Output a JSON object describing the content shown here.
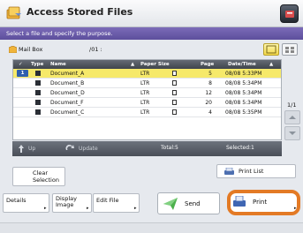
{
  "header": {
    "title": "Access Stored Files",
    "icon": "folder-stack-icon",
    "help_icon": "help-icon"
  },
  "instruction": "Select a file and specify the purpose.",
  "mailbox": {
    "label": "Mail Box",
    "path": "/01 :"
  },
  "table": {
    "columns": {
      "check": "✓",
      "type": "Type",
      "name": "Name",
      "paper": "Paper Size",
      "page": "Page",
      "datetime": "Date/Time"
    },
    "rows": [
      {
        "name": "Document_A",
        "paper": "LTR",
        "page": "5",
        "datetime": "08/08 5:33PM",
        "selected": true
      },
      {
        "name": "Document_B",
        "paper": "LTR",
        "page": "8",
        "datetime": "08/08 5:34PM",
        "selected": false
      },
      {
        "name": "Document_D",
        "paper": "LTR",
        "page": "12",
        "datetime": "08/08 5:34PM",
        "selected": false
      },
      {
        "name": "Document_F",
        "paper": "LTR",
        "page": "20",
        "datetime": "08/08 5:34PM",
        "selected": false
      },
      {
        "name": "Document_C",
        "paper": "LTR",
        "page": "4",
        "datetime": "08/08 5:35PM",
        "selected": false
      }
    ]
  },
  "pager": "1/1",
  "toolbar": {
    "up": "Up",
    "update": "Update",
    "total": "Total:5",
    "selected": "Selected:1"
  },
  "actions": {
    "clear_selection": "Clear Selection",
    "print_list": "Print List",
    "details": "Details",
    "display_image": "Display Image",
    "edit_file": "Edit File",
    "send": "Send",
    "print": "Print"
  },
  "colors": {
    "instruction_bar": "#6a5bab",
    "selected_row": "#f6e96a",
    "highlight": "#e37a25"
  }
}
